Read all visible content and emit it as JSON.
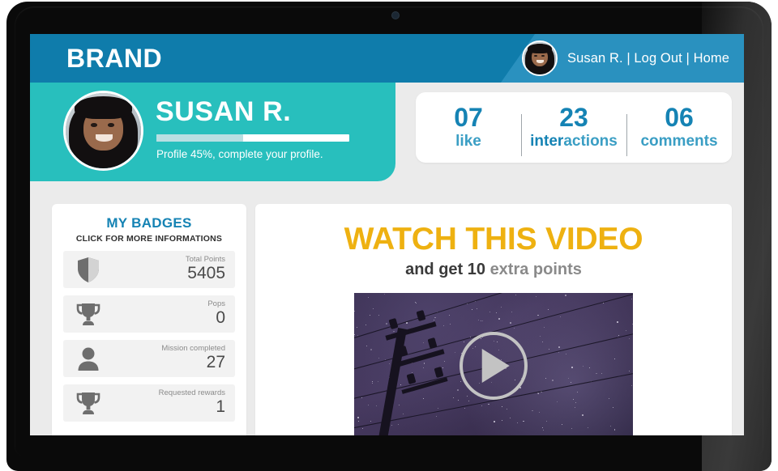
{
  "device": {
    "camera": "front-camera"
  },
  "topbar": {
    "brand": "BRAND",
    "nav_links": "Susan R. | Log Out | Home",
    "avatar_alt": "Susan R. avatar"
  },
  "profile": {
    "name": "SUSAN R.",
    "progress_percent": 45,
    "progress_text": "Profile 45%, complete your profile."
  },
  "stats": {
    "items": [
      {
        "value": "07",
        "label": "like"
      },
      {
        "value": "23",
        "label_dark": "inter",
        "label_light": "actions"
      },
      {
        "value": "06",
        "label": "comments"
      }
    ]
  },
  "badges": {
    "title": "MY BADGES",
    "subtitle": "CLICK FOR MORE INFORMATIONS",
    "items": [
      {
        "icon": "shield-icon",
        "label": "Total Points",
        "value": "5405"
      },
      {
        "icon": "trophy-icon",
        "label": "Pops",
        "value": "0"
      },
      {
        "icon": "person-icon",
        "label": "Mission completed",
        "value": "27"
      },
      {
        "icon": "trophy-icon",
        "label": "Requested rewards",
        "value": "1"
      }
    ]
  },
  "video": {
    "title": "WATCH THIS VIDEO",
    "subtitle_dark": "and get 10",
    "subtitle_muted": "extra points",
    "play_icon": "play-icon",
    "thumbnail_alt": "night sky with utility pole"
  },
  "colors": {
    "header_blue": "#0f7cab",
    "header_blue_light": "#2a91bf",
    "teal": "#28bfbd",
    "accent_blue": "#1583b4",
    "gold": "#eeb111",
    "page_bg": "#ebebeb"
  }
}
